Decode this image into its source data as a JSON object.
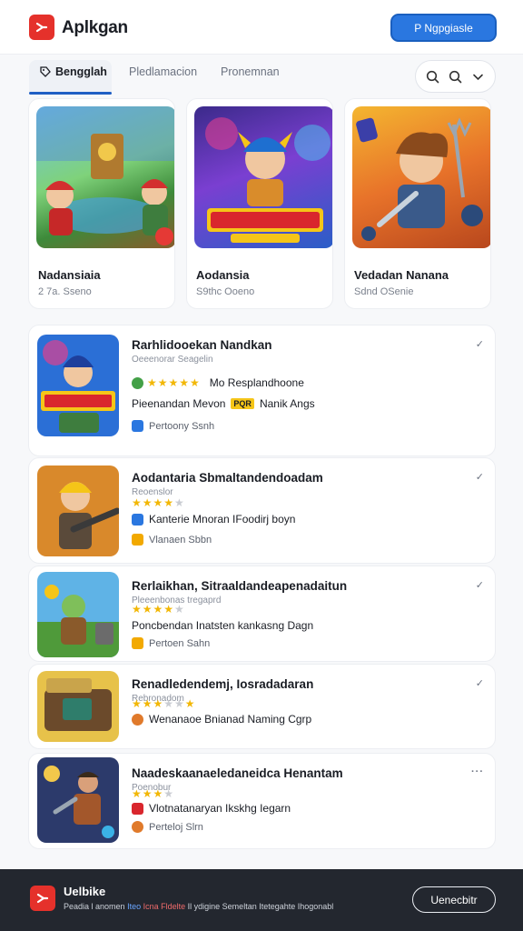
{
  "header": {
    "app_title": "Aplkgan",
    "cta_label": "P Ngpgiasle",
    "brand_color": "#e5312b",
    "accent_color": "#2a77e0"
  },
  "tabs": {
    "items": [
      {
        "label": "Bengglah",
        "active": true,
        "icon": "tag-icon"
      },
      {
        "label": "Pledlamacion",
        "active": false
      },
      {
        "label": "Pronemnan",
        "active": false
      }
    ],
    "tools": [
      "search-icon",
      "search-icon",
      "chevron-down-icon"
    ]
  },
  "featured": [
    {
      "title": "Nadansiaia",
      "sub": "2 7a. Sseno"
    },
    {
      "title": "Aodansia",
      "sub": "S9thc Ooeno"
    },
    {
      "title": "Vedadan Nanana",
      "sub": "Sdnd OSenie"
    }
  ],
  "list": [
    {
      "title": "Rarhlidooekan Nandkan",
      "sub": "Oeeenorar Seagelin",
      "rating": 5,
      "rating_label": "Mo Resplandhoone",
      "meta": "Pieenandan Mevon",
      "tag": "PQR",
      "meta_tail": "Nanik Angs",
      "foot": "Pertoony Ssnh"
    },
    {
      "title": "Aodantaria Sbmaltandendoadam",
      "sub": "Reoenslor",
      "rating": 3.5,
      "meta": "Kanterie Mnoran IFoodirj boyn",
      "foot": "Vlanaen Sbbn"
    },
    {
      "title": "Rerlaikhan, Sitraaldandeapenadaitun",
      "sub": "Pleeenbonas tregaprd",
      "rating": 3.5,
      "meta": "Poncbendan Inatsten kankasng Dagn",
      "foot": "Pertoen Sahn"
    },
    {
      "title": "Renadledendemj, Iosradadaran",
      "sub": "Rebronadom",
      "rating": 3.5,
      "meta": "Wenanaoe Bnianad Naming Cgrp",
      "foot": ""
    },
    {
      "title": "Naadeskaanaeledaneidca Henantam",
      "sub": "Poenobur",
      "rating": 3.5,
      "meta": "Vlotnatanaryan Ikskhg Iegarn",
      "foot": "Perteloj Slrn"
    }
  ],
  "bottom": {
    "title": "Uelbike",
    "sub_plain_a": "Peadia l anomen",
    "sub_blue": "Iteo",
    "sub_red": "Icna Fldelte",
    "sub_plain_b": "Il ydigine Semeltan Itetegahte Ihogonabl",
    "button_label": "Uenecbitr"
  }
}
